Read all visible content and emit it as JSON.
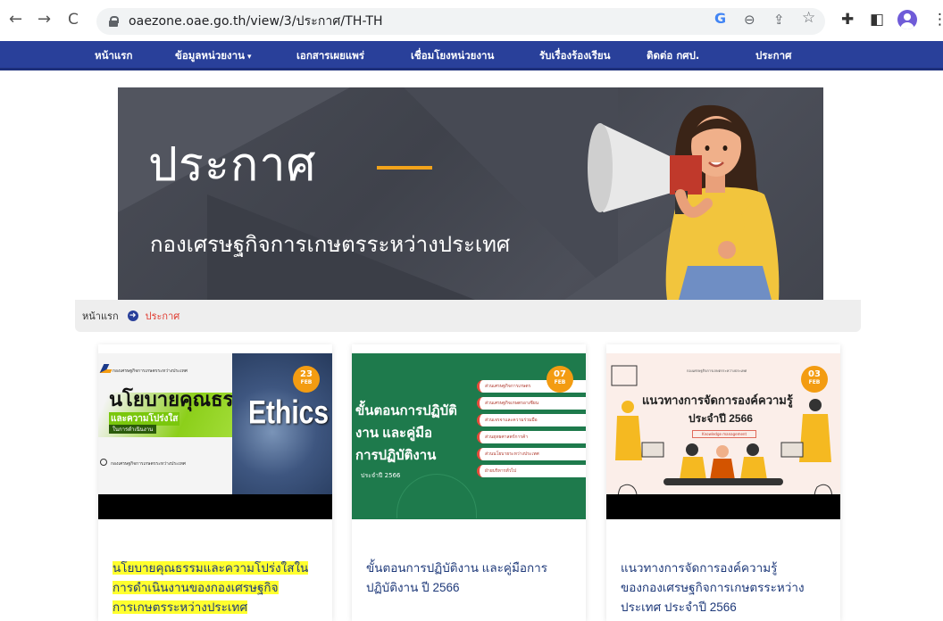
{
  "browser": {
    "url": "oaezone.oae.go.th/view/3/ประกาศ/TH-TH",
    "back_icon": "←",
    "forward_icon": "→",
    "reload_icon": "C",
    "google_icon": "G",
    "zoom_icon": "⊖",
    "share_icon": "⇪",
    "star_icon": "☆",
    "extensions_icon": "✚",
    "sidepanel_icon": "◧",
    "menu_icon": "⋮"
  },
  "sitenav": {
    "items": [
      "หน้าแรก",
      "ข้อมูลหน่วยงาน",
      "เอกสารเผยแพร่",
      "เชื่อมโยงหน่วยงาน",
      "รับเรื่องร้องเรียน",
      "ติดต่อ กศป.",
      "ประกาศ"
    ],
    "dropdown_caret": "▾"
  },
  "hero": {
    "title": "ประกาศ",
    "subtitle": "กองเศรษฐกิจการเกษตรระหว่างประเทศ"
  },
  "breadcrumb": {
    "home": "หน้าแรก",
    "current": "ประกาศ",
    "separator_icon": "➜"
  },
  "cards": [
    {
      "date_day": "23",
      "date_month": "FEB",
      "thumb": {
        "org": "กองเศรษฐกิจการเกษตรระหว่างประเทศ",
        "headline": "นโยบายคุณธรรม",
        "sub": "และความโปร่งใส",
        "tag": "ในการดำเนินงาน",
        "art": "Ethics",
        "footer": "กองเศรษฐกิจการเกษตรระหว่างประเทศ"
      },
      "caption_lines": [
        "นโยบายคุณธรรมและความโปร่งใสใน",
        "การดำเนินงานของกองเศรษฐกิจ",
        "การเกษตรระหว่างประเทศ"
      ]
    },
    {
      "date_day": "07",
      "date_month": "FEB",
      "thumb": {
        "title_lines": [
          "ขั้นตอนการปฏิบัติ",
          "งาน และคู่มือ",
          "การปฏิบัติงาน"
        ],
        "year": "ประจำปี 2566",
        "steps": [
          "ส่วนเศรษฐกิจการเกษตร",
          "ส่วนเศรษฐกิจเกษตรอาเซียน",
          "ส่วนเจรจาและความร่วมมือ",
          "ส่วนยุทธศาสตร์การค้า",
          "ส่วนนโยบายระหว่างประเทศ",
          "ฝ่ายบริหารทั่วไป"
        ]
      },
      "caption_lines": [
        "ขั้นตอนการปฏิบัติงาน และคู่มือการ",
        "ปฏิบัติงาน ปี 2566"
      ]
    },
    {
      "date_day": "03",
      "date_month": "FEB",
      "thumb": {
        "top_text": "กองเศรษฐกิจการเกษตรระหว่างประเทศ",
        "title": "แนวทางการจัดการองค์ความรู้",
        "sub": "ประจำปี 2566",
        "tag": "Knowledge management"
      },
      "caption_lines": [
        "แนวทางการจัดการองค์ความรู้",
        "ของกองเศรษฐกิจการเกษตรระหว่าง",
        "ประเทศ ประจำปี 2566"
      ]
    }
  ],
  "colors": {
    "nav_bg": "#29409a",
    "badge": "#f39c12",
    "highlight": "#ffff2e",
    "caption": "#1f3a7a",
    "crumb_current": "#e03a2f"
  }
}
